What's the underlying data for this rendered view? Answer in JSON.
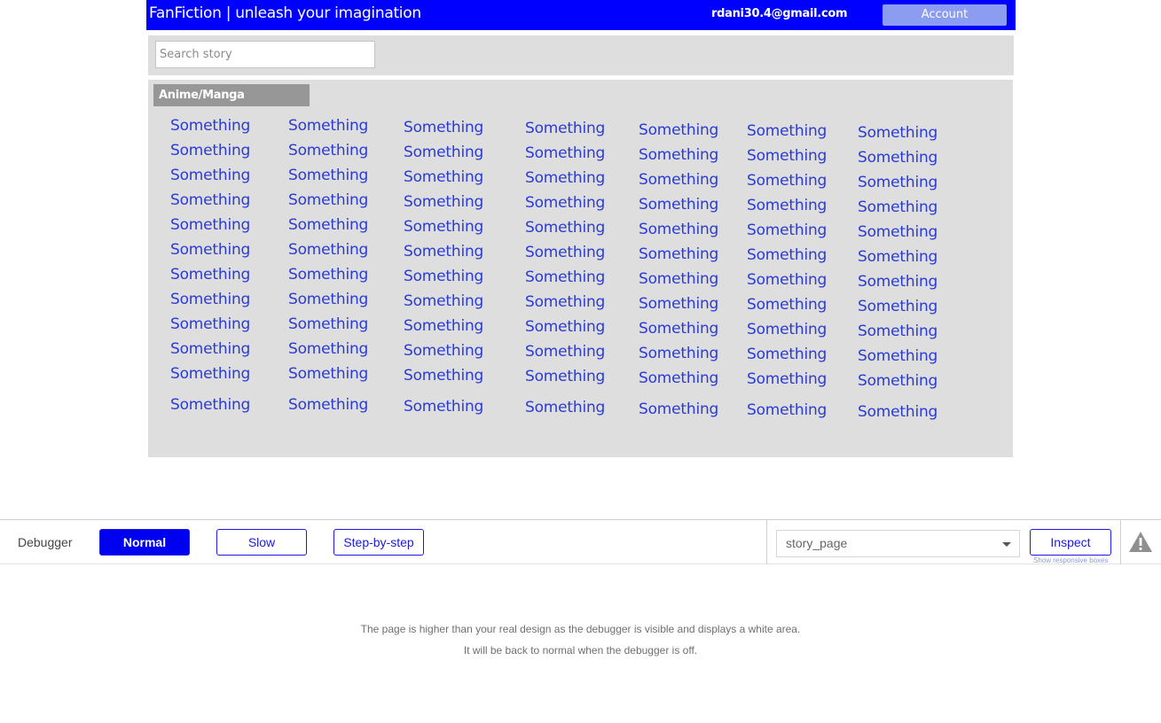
{
  "header": {
    "title": "FanFiction | unleash your imagination",
    "user_email": "rdani30.4@gmail.com",
    "account_label": "Account",
    "colors": {
      "bar": "#0000ff",
      "account_button": "#8c9cf0"
    }
  },
  "search": {
    "placeholder": "Search story",
    "value": ""
  },
  "category": {
    "name": "Anime/Manga",
    "columns": [
      [
        "Something",
        "Something",
        "Something",
        "Something",
        "Something",
        "Something",
        "Something",
        "Something",
        "Something",
        "Something",
        "Something",
        "Something"
      ],
      [
        "Something",
        "Something",
        "Something",
        "Something",
        "Something",
        "Something",
        "Something",
        "Something",
        "Something",
        "Something",
        "Something",
        "Something"
      ],
      [
        "Something",
        "Something",
        "Something",
        "Something",
        "Something",
        "Something",
        "Something",
        "Something",
        "Something",
        "Something",
        "Something",
        "Something"
      ],
      [
        "Something",
        "Something",
        "Something",
        "Something",
        "Something",
        "Something",
        "Something",
        "Something",
        "Something",
        "Something",
        "Something",
        "Something"
      ],
      [
        "Something",
        "Something",
        "Something",
        "Something",
        "Something",
        "Something",
        "Something",
        "Something",
        "Something",
        "Something",
        "Something",
        "Something"
      ],
      [
        "Something",
        "Something",
        "Something",
        "Something",
        "Something",
        "Something",
        "Something",
        "Something",
        "Something",
        "Something",
        "Something",
        "Something"
      ],
      [
        "Something",
        "Something",
        "Something",
        "Something",
        "Something",
        "Something",
        "Something",
        "Something",
        "Something",
        "Something",
        "Something",
        "Something"
      ]
    ]
  },
  "debugger": {
    "label": "Debugger",
    "modes": [
      "Normal",
      "Slow",
      "Step-by-step"
    ],
    "active_mode": "Normal",
    "page_select": "story_page",
    "inspect_label": "Inspect",
    "responsive_note": "Show responsive boxes",
    "warning_icon": "warning-triangle-icon"
  },
  "footer_notes": [
    "The page is higher than your real design as the debugger is visible and displays a white area.",
    "It will be back to normal when the debugger is off."
  ]
}
